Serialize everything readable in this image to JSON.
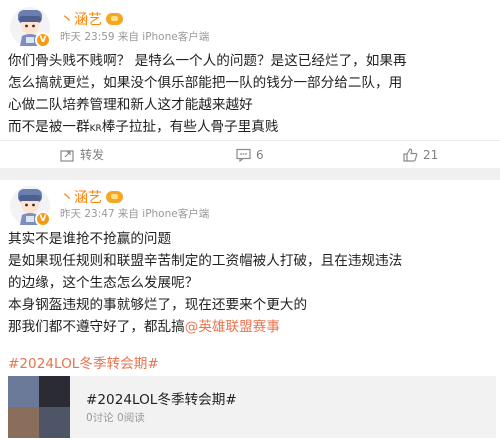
{
  "posts": [
    {
      "user": {
        "name": "丶涵艺"
      },
      "meta": "昨天 23:59 来自 iPhone客户端",
      "lines": [
        "你们骨头贱不贱啊？ 是特么一个人的问题？是这已经烂了，如果再",
        "怎么搞就更烂，如果没个俱乐部能把一队的钱分一部分给二队，用",
        "心做二队培养管理和新人这才能越来越好"
      ],
      "line4_pre": "而不是被一群",
      "line4_kr": "KR",
      "line4_post": "棒子拉扯，有些人骨子里真贱",
      "actions": {
        "repost": "转发",
        "comments": "6",
        "likes": "21"
      }
    },
    {
      "user": {
        "name": "丶涵艺"
      },
      "meta": "昨天 23:47 来自 iPhone客户端",
      "lines": [
        "其实不是谁抢不抢赢的问题",
        "是如果现任规则和联盟辛苦制定的工资帽被人打破，且在违规违法",
        "的边缘，这个生态怎么发展呢？",
        "本身钢盔违规的事就够烂了，现在还要来个更大的"
      ],
      "line5_pre": "那我们都不遵守好了，都乱搞",
      "mention": "@英雄联盟赛事",
      "hashtag": "#2024LOL冬季转会期#",
      "topic": {
        "title": "#2024LOL冬季转会期#",
        "stats": "0讨论 0阅读"
      }
    }
  ],
  "colors": {
    "username": "#ff8200",
    "link": "#eb7350",
    "meta": "#999999"
  }
}
